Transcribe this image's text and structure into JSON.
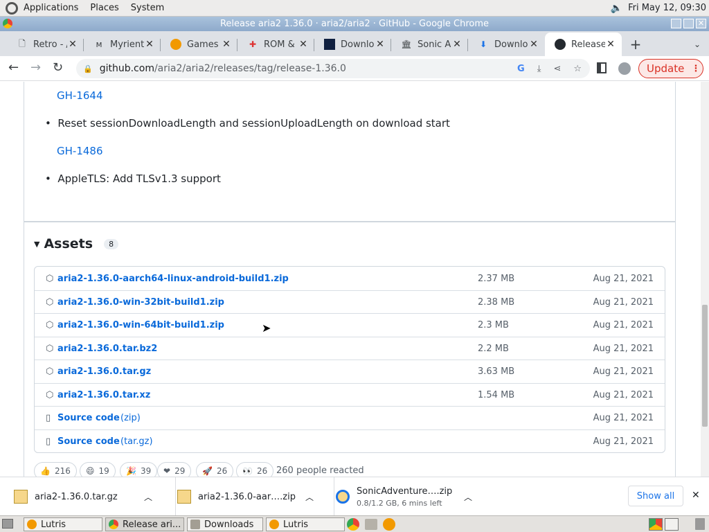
{
  "desktop": {
    "menus": [
      "Applications",
      "Places",
      "System"
    ],
    "clock": "Fri May 12, 09:30"
  },
  "window": {
    "title": "Release aria2 1.36.0 · aria2/aria2 · GitHub - Google Chrome"
  },
  "tabs": [
    {
      "label": "Retro - /",
      "icon": "document-icon"
    },
    {
      "label": "Myrient",
      "icon": "myrient-icon"
    },
    {
      "label": "Games",
      "icon": "archive-icon"
    },
    {
      "label": "ROM &",
      "icon": "rom-icon"
    },
    {
      "label": "Downloa",
      "icon": "download-site-icon"
    },
    {
      "label": "Sonic A",
      "icon": "archive-org-icon"
    },
    {
      "label": "Downloa",
      "icon": "download-arrow-icon"
    },
    {
      "label": "Release",
      "icon": "github-icon",
      "active": true
    }
  ],
  "address": {
    "host": "github.com",
    "path": "/aria2/aria2/releases/tag/release-1.36.0"
  },
  "update_label": "Update",
  "notes": {
    "link_1": "GH-1644",
    "bullet_1": "Reset sessionDownloadLength and sessionUploadLength on download start",
    "link_2": "GH-1486",
    "bullet_2": "AppleTLS: Add TLSv1.3 support"
  },
  "assets": {
    "heading": "Assets",
    "count": "8",
    "items": [
      {
        "name": "aria2-1.36.0-aarch64-linux-android-build1.zip",
        "size": "2.37 MB",
        "date": "Aug 21, 2021"
      },
      {
        "name": "aria2-1.36.0-win-32bit-build1.zip",
        "size": "2.38 MB",
        "date": "Aug 21, 2021"
      },
      {
        "name": "aria2-1.36.0-win-64bit-build1.zip",
        "size": "2.3 MB",
        "date": "Aug 21, 2021"
      },
      {
        "name": "aria2-1.36.0.tar.bz2",
        "size": "2.2 MB",
        "date": "Aug 21, 2021"
      },
      {
        "name": "aria2-1.36.0.tar.gz",
        "size": "3.63 MB",
        "date": "Aug 21, 2021"
      },
      {
        "name": "aria2-1.36.0.tar.xz",
        "size": "1.54 MB",
        "date": "Aug 21, 2021"
      },
      {
        "name": "Source code",
        "suffix": "(zip)",
        "size": "",
        "date": "Aug 21, 2021"
      },
      {
        "name": "Source code",
        "suffix": "(tar.gz)",
        "size": "",
        "date": "Aug 21, 2021"
      }
    ]
  },
  "reactions": {
    "items": [
      {
        "emoji": "👍",
        "count": "216"
      },
      {
        "emoji": "😄",
        "count": "19"
      },
      {
        "emoji": "🎉",
        "count": "39"
      },
      {
        "emoji": "❤",
        "count": "29"
      },
      {
        "emoji": "🚀",
        "count": "26"
      },
      {
        "emoji": "👀",
        "count": "26"
      }
    ],
    "summary": "260 people reacted"
  },
  "downloads": {
    "items": [
      {
        "name": "aria2-1.36.0.tar.gz",
        "status": ""
      },
      {
        "name": "aria2-1.36.0-aar….zip",
        "status": ""
      },
      {
        "name": "SonicAdventure….zip",
        "status": "0.8/1.2 GB, 6 mins left"
      }
    ],
    "show_all": "Show all"
  },
  "taskbar": {
    "items": [
      "Lutris",
      "Release ari...",
      "Downloads",
      "Lutris"
    ]
  }
}
